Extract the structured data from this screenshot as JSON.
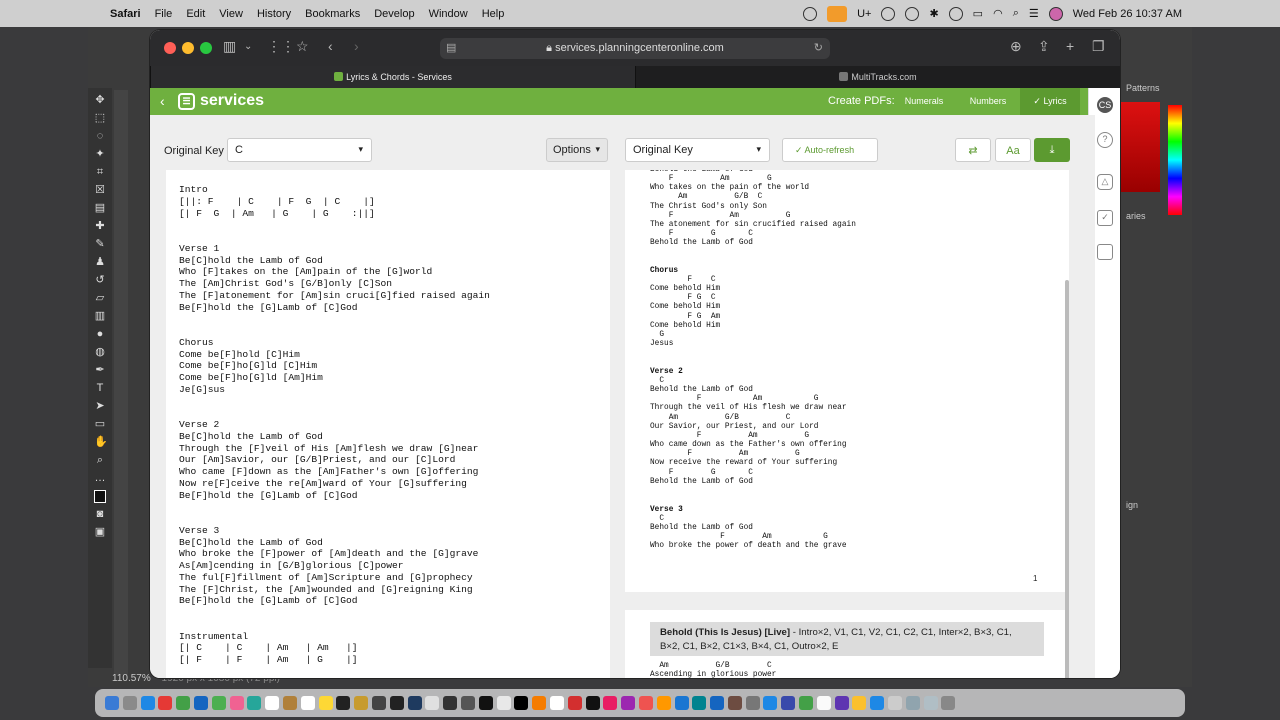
{
  "menubar": {
    "app": "Safari",
    "items": [
      "File",
      "Edit",
      "View",
      "History",
      "Bookmarks",
      "Develop",
      "Window",
      "Help"
    ],
    "clock": "Wed Feb 26  10:37 AM"
  },
  "ps": {
    "zoom": "110.57%",
    "panel1": "Patterns",
    "panel2": "aries",
    "panel3": "ign",
    "doc_info": "1920 px x 1080 px (72 ppi)"
  },
  "browser": {
    "url": "services.planningcenteronline.com",
    "tabs": [
      {
        "label": "Lyrics & Chords - Services"
      },
      {
        "label": "MultiTracks.com"
      }
    ]
  },
  "app": {
    "logo": "services",
    "create_pdfs": "Create PDFs:",
    "pdf_buttons": [
      "Numerals",
      "Numbers",
      "Lyrics"
    ],
    "selected": "Lyrics",
    "avatar": "CS"
  },
  "toolbar": {
    "original_key_label": "Original Key",
    "key_value": "C",
    "options": "Options",
    "original_key_select": "Original Key",
    "auto_refresh": "Auto-refresh",
    "text_size": "Aa"
  },
  "chord_chart": "Intro\n[||: F    | C    | F  G  | C    |]\n[| F  G  | Am   | G    | G    :||]\n\n\nVerse 1\nBe[C]hold the Lamb of God\nWho [F]takes on the [Am]pain of the [G]world\nThe [Am]Christ God's [G/B]only [C]Son\nThe [F]atonement for [Am]sin cruci[G]fied raised again\nBe[F]hold the [G]Lamb of [C]God\n\n\nChorus\nCome be[F]hold [C]Him\nCome be[F]ho[G]ld [C]Him\nCome be[F]ho[G]ld [Am]Him\nJe[G]sus\n\n\nVerse 2\nBe[C]hold the Lamb of God\nThrough the [F]veil of His [Am]flesh we draw [G]near\nOur [Am]Savior, our [G/B]Priest, and our [C]Lord\nWho came [F]down as the [Am]Father's own [G]offering\nNow re[F]ceive the re[Am]ward of Your [G]suffering\nBe[F]hold the [G]Lamb of [C]God\n\n\nVerse 3\nBe[C]hold the Lamb of God\nWho broke the [F]power of [Am]death and the [G]grave\nAs[Am]cending in [G/B]glorious [C]power\nThe ful[F]fillment of [Am]Scripture and [G]prophecy\nThe [F]Christ, the [Am]wounded and [G]reigning King\nBe[F]hold the [G]Lamb of [C]God\n\n\nInstrumental\n[| C    | C    | Am   | Am   |]\n[| F    | F    | Am   | G    |]",
  "preview": {
    "block1": "Behold the Lamb of God\n    F          Am        G\nWho takes on the pain of the world\n      Am          G/B  C\nThe Christ God's only Son\n    F            Am          G\nThe atonement for sin crucified raised again\n    F        G       C\nBehold the Lamb of God",
    "chorus_title": "Chorus",
    "chorus": "        F    C\nCome behold Him\n        F G  C\nCome behold Him\n        F G  Am\nCome behold Him\n  G\nJesus",
    "verse2_title": "Verse 2",
    "verse2": "  C\nBehold the Lamb of God\n          F           Am           G\nThrough the veil of His flesh we draw near\n    Am          G/B          C\nOur Savior, our Priest, and our Lord\n          F          Am          G\nWho came down as the Father's own offering\n        F          Am          G\nNow receive the reward of Your suffering\n    F        G       C\nBehold the Lamb of God",
    "verse3_title": "Verse 3",
    "verse3": "  C\nBehold the Lamb of God\n               F        Am           G\nWho broke the power of death and the grave",
    "page_number": "1",
    "song_title": "Behold (This Is Jesus) [Live]",
    "song_order": " - Intro×2, V1, C1, V2, C1, C2, C1, Inter×2, B×3, C1, B×2, C1, B×2, C1×3, B×4, C1, Outro×2, E",
    "page2": "  Am          G/B        C\nAscending in glorious power\n        F           Am          G"
  }
}
